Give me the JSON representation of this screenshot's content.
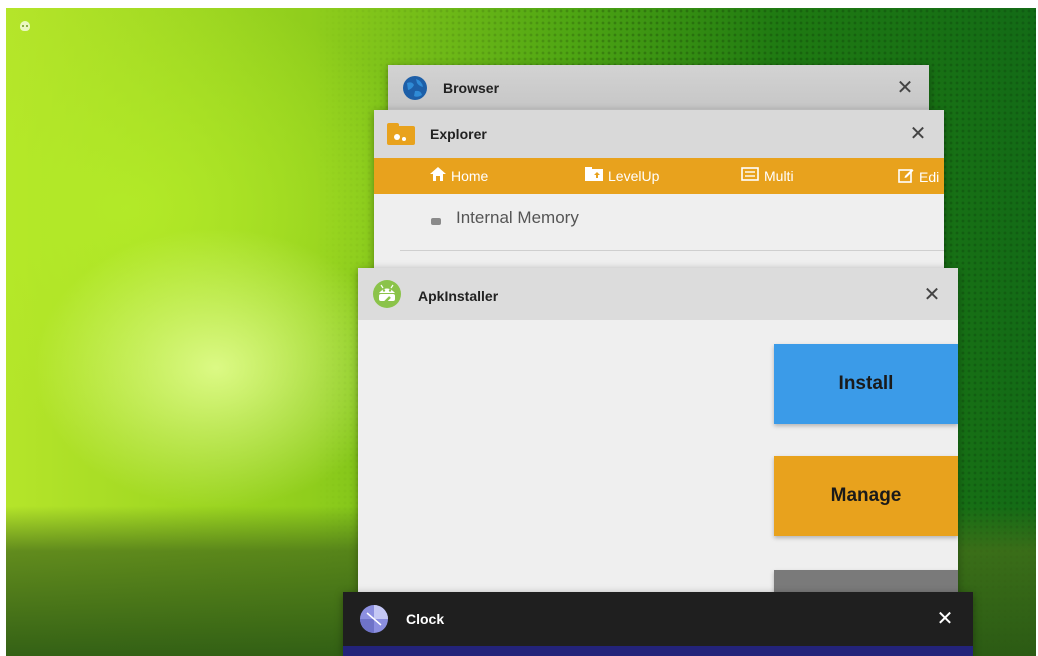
{
  "desktop": {
    "corner_icon": "android-icon"
  },
  "windows": {
    "browser": {
      "title": "Browser",
      "icon": "globe-icon",
      "close_glyph": "✕"
    },
    "explorer": {
      "title": "Explorer",
      "icon": "folder-icon",
      "close_glyph": "✕",
      "toolbar": [
        {
          "label": "Home",
          "icon": "home-icon"
        },
        {
          "label": "LevelUp",
          "icon": "folder-up-icon"
        },
        {
          "label": "Multi",
          "icon": "multi-select-icon"
        },
        {
          "label": "Edi",
          "icon": "edit-icon"
        }
      ],
      "storage_item": "Internal Memory",
      "accent": "#e8a21d"
    },
    "apkinstaller": {
      "title": "ApkInstaller",
      "icon": "android-wrench-icon",
      "close_glyph": "✕",
      "buttons": {
        "install": {
          "label": "Install",
          "color": "#3b9be8"
        },
        "manage": {
          "label": "Manage",
          "color": "#e8a21d"
        },
        "third": {
          "label": "",
          "color": "#7a7a7a"
        }
      }
    },
    "clock": {
      "title": "Clock",
      "icon": "clock-icon",
      "close_glyph": "✕"
    }
  }
}
